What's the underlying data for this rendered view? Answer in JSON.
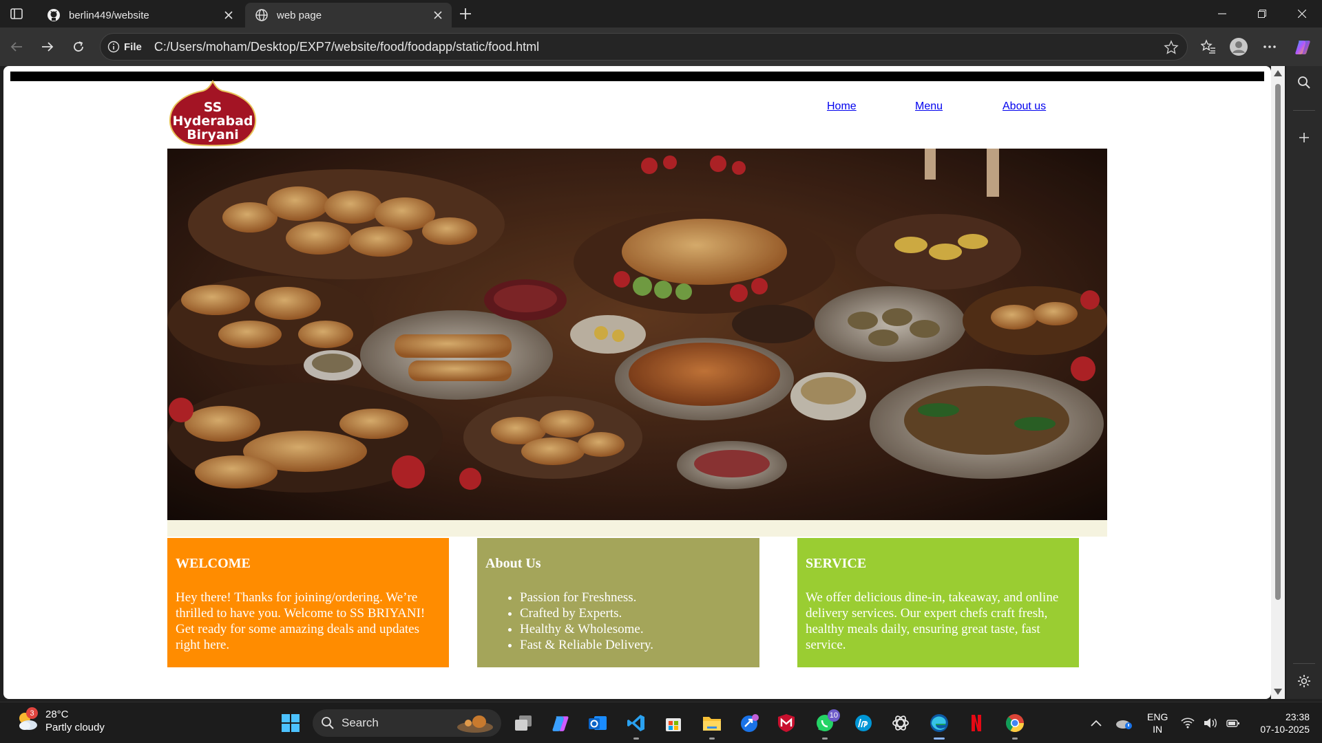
{
  "browser": {
    "tabs": [
      {
        "title": "berlin449/website",
        "icon": "github-icon",
        "active": false
      },
      {
        "title": "web page",
        "icon": "globe-icon",
        "active": true
      }
    ],
    "address": {
      "scheme_label": "File",
      "url": "C:/Users/moham/Desktop/EXP7/website/food/foodapp/static/food.html"
    }
  },
  "page": {
    "logo_text": "SS Hyderabad Biryani",
    "nav": [
      "Home",
      "Menu",
      "About us"
    ],
    "hero_alt": "Table filled with food dishes",
    "welcome": {
      "title": "WELCOME",
      "body": "Hey there! Thanks for joining/ordering. We’re thrilled to have you. Welcome to SS BRIYANI! Get ready for some amazing deals and updates right here."
    },
    "about": {
      "title": "About Us",
      "items": [
        "Passion for Freshness.",
        "Crafted by Experts.",
        "Healthy & Wholesome.",
        "Fast & Reliable Delivery."
      ]
    },
    "service": {
      "title": "SERVICE",
      "body": "We offer delicious dine-in, takeaway, and online delivery services. Our expert chefs craft fresh, healthy meals daily, ensuring great taste, fast service."
    },
    "colors": {
      "welcome": "#ff8c00",
      "about": "#a4a55a",
      "service": "#9acd32",
      "logo": "#a31424"
    }
  },
  "taskbar": {
    "weather": {
      "temp": "28°C",
      "condition": "Partly cloudy",
      "badge": "3"
    },
    "search_label": "Search",
    "whatsapp_badge": "10",
    "language": {
      "line1": "ENG",
      "line2": "IN"
    },
    "clock": {
      "time": "23:38",
      "date": "07-10-2025"
    }
  }
}
